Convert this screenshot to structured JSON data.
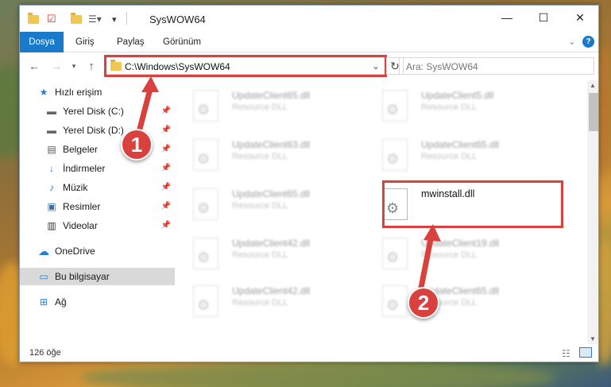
{
  "window": {
    "title": "SysWOW64",
    "controls": {
      "minimize": "—",
      "maximize": "☐",
      "close": "✕"
    }
  },
  "ribbon": {
    "tabs": [
      {
        "label": "Dosya",
        "active": true
      },
      {
        "label": "Giriş",
        "active": false
      },
      {
        "label": "Paylaş",
        "active": false
      },
      {
        "label": "Görünüm",
        "active": false
      }
    ]
  },
  "navigation": {
    "address": "C:\\Windows\\SysWOW64",
    "search_placeholder": "Ara: SysWOW64"
  },
  "sidebar": {
    "items": [
      {
        "label": "Hızlı erişim",
        "icon": "star-icon",
        "pinned": false
      },
      {
        "label": "Yerel Disk (C:)",
        "icon": "drive-icon",
        "pinned": true
      },
      {
        "label": "Yerel Disk (D:)",
        "icon": "drive-icon",
        "pinned": true
      },
      {
        "label": "Belgeler",
        "icon": "document-icon",
        "pinned": true
      },
      {
        "label": "İndirmeler",
        "icon": "download-icon",
        "pinned": true
      },
      {
        "label": "Müzik",
        "icon": "music-icon",
        "pinned": true
      },
      {
        "label": "Resimler",
        "icon": "image-icon",
        "pinned": true
      },
      {
        "label": "Videolar",
        "icon": "video-icon",
        "pinned": true
      },
      {
        "label": "OneDrive",
        "icon": "cloud-icon",
        "pinned": false
      },
      {
        "label": "Bu bilgisayar",
        "icon": "computer-icon",
        "pinned": false,
        "selected": true
      },
      {
        "label": "Ağ",
        "icon": "network-icon",
        "pinned": false
      }
    ]
  },
  "files": [
    {
      "name": "UpdateClient65.dll",
      "desc": "Resource DLL",
      "blurred": true
    },
    {
      "name": "UpdateClient5.dll",
      "desc": "Resource DLL",
      "blurred": true
    },
    {
      "name": "UpdateClient63.dll",
      "desc": "Resource DLL",
      "blurred": true
    },
    {
      "name": "UpdateClient65.dll",
      "desc": "Resource DLL",
      "blurred": true
    },
    {
      "name": "UpdateClient65.dll",
      "desc": "Resource DLL",
      "blurred": true
    },
    {
      "name": "mwinstall.dll",
      "desc": "",
      "blurred": false
    },
    {
      "name": "UpdateClient42.dll",
      "desc": "Resource DLL",
      "blurred": true
    },
    {
      "name": "UpdateClient19.dll",
      "desc": "Resource DLL",
      "blurred": true
    },
    {
      "name": "UpdateClient42.dll",
      "desc": "Resource DLL",
      "blurred": true
    },
    {
      "name": "UpdateClient65.dll",
      "desc": "Resource DLL",
      "blurred": true
    }
  ],
  "status": {
    "item_count": "126 öğe"
  },
  "annotations": {
    "marker1": "1",
    "marker2": "2"
  },
  "colors": {
    "accent": "#1979ca",
    "highlight": "#d9413e"
  }
}
